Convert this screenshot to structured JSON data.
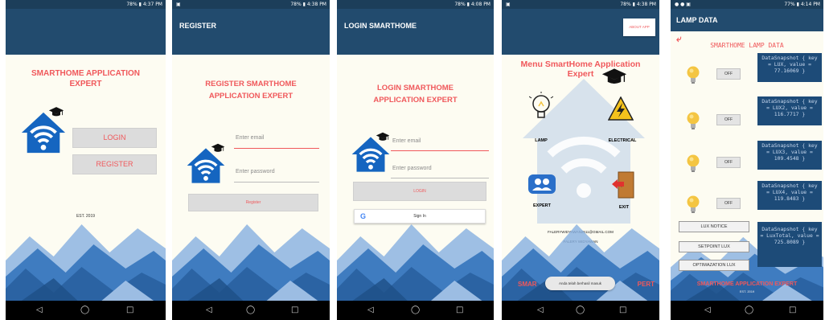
{
  "colors": {
    "appbar": "#224b6e",
    "statusbar": "#1c3e5a",
    "accent": "#f0585b",
    "mountain_dark": "#2b63a3",
    "mountain_light": "#86afe0"
  },
  "nav_icons": [
    "back-icon",
    "home-icon",
    "recents-icon"
  ],
  "screen1": {
    "status_time": "4:37 PM",
    "status_battery": "78%",
    "title_line1": "SMARTHOME APPLICATION",
    "title_line2": "EXPERT",
    "login_button": "LOGIN",
    "register_button": "REGISTER",
    "est": "EST. 2019"
  },
  "screen2": {
    "status_time": "4:38 PM",
    "status_battery": "78%",
    "appbar_title": "REGISTER",
    "header_line1": "REGISTER SMARTHOME",
    "header_line2": "APPLICATION EXPERT",
    "email_placeholder": "Enter email",
    "password_placeholder": "Enter password",
    "register_button": "Register"
  },
  "screen3": {
    "status_time": "4:08 PM",
    "status_battery": "78%",
    "appbar_title": "LOGIN SMARTHOME",
    "header_line1": "LOGIN SMARTHOME",
    "header_line2": "APPLICATION EXPERT",
    "email_placeholder": "Enter email",
    "password_placeholder": "Enter password",
    "login_button": "LOGIN",
    "google_signin": "Sign In"
  },
  "screen4": {
    "status_time": "4:38 PM",
    "status_battery": "78%",
    "about_button": "ABOUT APP",
    "title_line1": "Menu SmartHome Application",
    "title_line2": "Expert",
    "menu": {
      "lamp": "LAMP",
      "electrical": "ELECTRICAL",
      "expert": "EXPERT",
      "exit": "EXIT"
    },
    "email": "FALERYWIDYAWAN2511@GMAIL.COM",
    "name": "FALERY WIDYAWAN",
    "toast": "Anda telah berhasil masuk",
    "footer_left": "SMAR",
    "footer_right": "PERT"
  },
  "screen5": {
    "status_time": "4:14 PM",
    "status_battery": "77%",
    "appbar_title": "LAMP DATA",
    "header": "SMARTHOME LAMP DATA",
    "rows": [
      {
        "button": "OFF",
        "snapshot": "DataSnapshot { key = LUX, value = 77.16069 }"
      },
      {
        "button": "OFF",
        "snapshot": "DataSnapshot { key = LUX2, value = 116.7717 }"
      },
      {
        "button": "OFF",
        "snapshot": "DataSnapshot { key = LUX3, value = 109.4548 }"
      },
      {
        "button": "OFF",
        "snapshot": "DataSnapshot { key = LUX4, value = 119.8483 }"
      }
    ],
    "lux_notice": "LUX NOTICE",
    "setpoint_lux": "SETPOINT LUX",
    "optimization_lux": "OPTIMAZATION LUX",
    "total_snapshot": "DataSnapshot { key = LuxTotal, value = 725.8089 }",
    "footer": "SMARTHOME APPLICATION EXPERT",
    "footer_est": "EST. 2019"
  }
}
